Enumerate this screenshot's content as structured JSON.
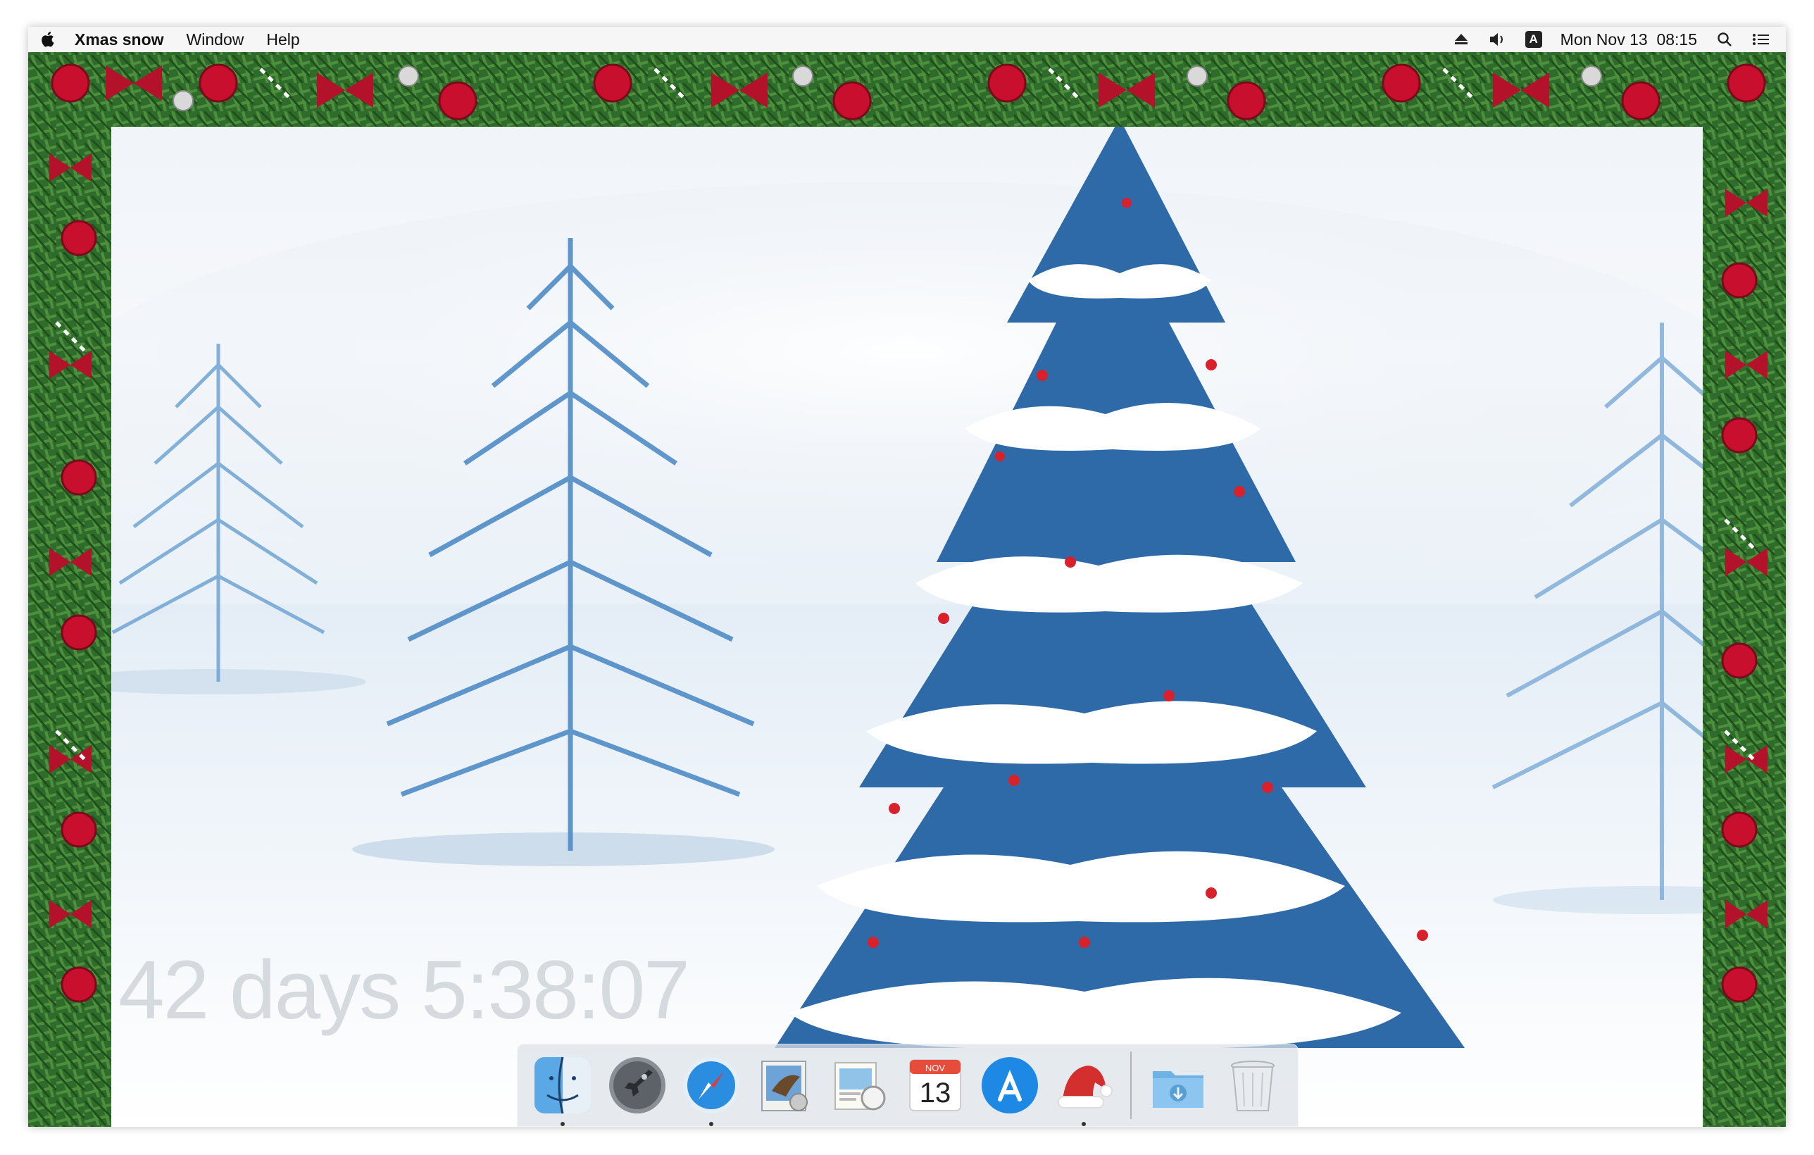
{
  "menubar": {
    "app_name": "Xmas snow",
    "menus": [
      "Window",
      "Help"
    ],
    "datetime": "Mon Nov 13  08:15",
    "input_badge": "A",
    "icons": [
      "apple-icon",
      "eject-icon",
      "volume-icon",
      "input-source-icon",
      "spotlight-search-icon",
      "notification-center-icon"
    ]
  },
  "countdown": {
    "text": "42 days 5:38:07"
  },
  "dock": {
    "apps": [
      {
        "name": "Finder",
        "icon": "finder-icon"
      },
      {
        "name": "Launchpad",
        "icon": "launchpad-icon"
      },
      {
        "name": "Safari",
        "icon": "safari-icon"
      },
      {
        "name": "Mail",
        "icon": "mail-icon"
      },
      {
        "name": "Preview",
        "icon": "preview-icon"
      },
      {
        "name": "Calendar",
        "icon": "calendar-icon",
        "month": "NOV",
        "day": "13"
      },
      {
        "name": "App Store",
        "icon": "app-store-icon"
      },
      {
        "name": "Xmas snow",
        "icon": "santa-hat-icon"
      }
    ],
    "others": [
      {
        "name": "Downloads",
        "icon": "downloads-folder-icon"
      },
      {
        "name": "Trash",
        "icon": "trash-icon"
      }
    ]
  },
  "colors": {
    "garland_green": "#2f6b2a",
    "ornament_red": "#c8102e",
    "tree_blue": "#3b7fc0",
    "snow": "#ffffff"
  }
}
